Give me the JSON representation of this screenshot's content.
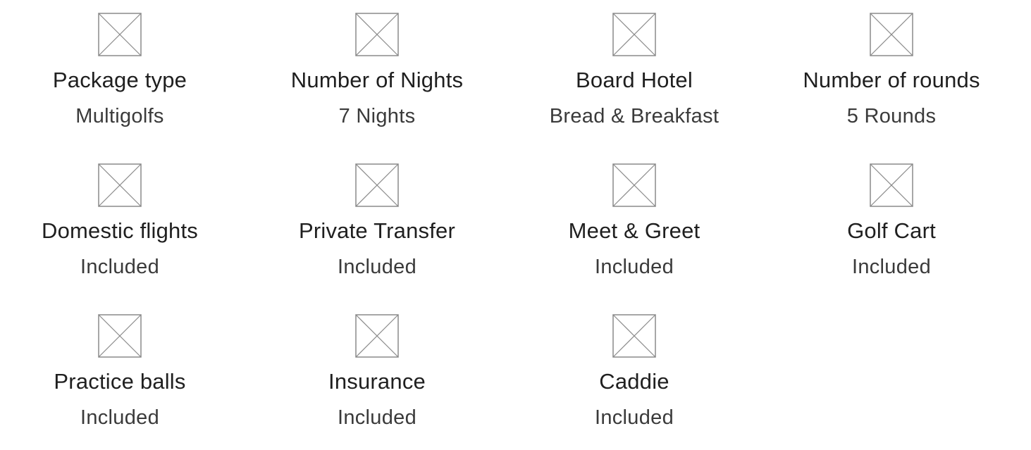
{
  "features": [
    {
      "label": "Package type",
      "value": "Multigolfs",
      "icon": "placeholder-image-icon"
    },
    {
      "label": "Number of Nights",
      "value": "7 Nights",
      "icon": "placeholder-image-icon"
    },
    {
      "label": "Board Hotel",
      "value": "Bread & Breakfast",
      "icon": "placeholder-image-icon"
    },
    {
      "label": "Number of rounds",
      "value": "5 Rounds",
      "icon": "placeholder-image-icon"
    },
    {
      "label": "Domestic flights",
      "value": "Included",
      "icon": "placeholder-image-icon"
    },
    {
      "label": "Private Transfer",
      "value": "Included",
      "icon": "placeholder-image-icon"
    },
    {
      "label": "Meet & Greet",
      "value": "Included",
      "icon": "placeholder-image-icon"
    },
    {
      "label": "Golf Cart",
      "value": "Included",
      "icon": "placeholder-image-icon"
    },
    {
      "label": "Practice balls",
      "value": "Included",
      "icon": "placeholder-image-icon"
    },
    {
      "label": "Insurance",
      "value": "Included",
      "icon": "placeholder-image-icon"
    },
    {
      "label": "Caddie",
      "value": "Included",
      "icon": "placeholder-image-icon"
    }
  ],
  "colors": {
    "icon_stroke": "#8a8a8a",
    "label": "#1f1f1f",
    "value": "#3a3a3a"
  }
}
